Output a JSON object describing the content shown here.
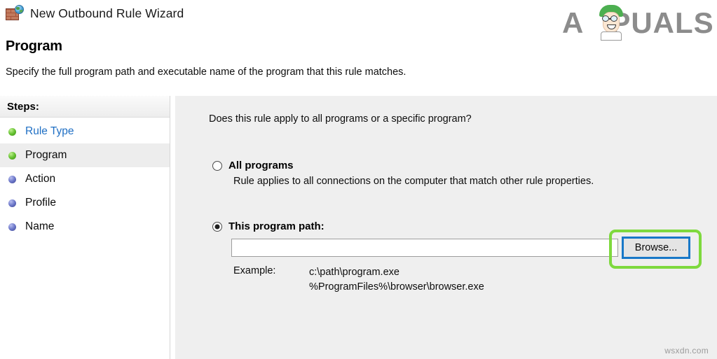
{
  "window": {
    "title": "New Outbound Rule Wizard",
    "icon": "firewall-brick-wall-globe-icon"
  },
  "header": {
    "heading": "Program",
    "subheading": "Specify the full program path and executable name of the program that this rule matches."
  },
  "logo": {
    "text": "A PUALS",
    "prefix": "A",
    "suffix": "PUALS",
    "color": "#8c8c8c",
    "hair_color": "#4caf50"
  },
  "sidebar": {
    "header_label": "Steps:",
    "items": [
      {
        "label": "Rule Type",
        "bullet": "green",
        "state": "completed-link",
        "active": false
      },
      {
        "label": "Program",
        "bullet": "green",
        "state": "current",
        "active": true
      },
      {
        "label": "Action",
        "bullet": "blue",
        "state": "pending",
        "active": false
      },
      {
        "label": "Profile",
        "bullet": "blue",
        "state": "pending",
        "active": false
      },
      {
        "label": "Name",
        "bullet": "blue",
        "state": "pending",
        "active": false
      }
    ]
  },
  "content": {
    "question": "Does this rule apply to all programs or a specific program?",
    "options": [
      {
        "id": "all-programs",
        "label": "All programs",
        "description": "Rule applies to all connections on the computer that match other rule properties.",
        "selected": false
      },
      {
        "id": "this-program-path",
        "label": "This program path:",
        "selected": true
      }
    ],
    "path_input": {
      "value": "",
      "placeholder": ""
    },
    "browse_button": {
      "label": "Browse...",
      "focus_border_color": "#1878c8",
      "highlight_color": "#7ed93e"
    },
    "example": {
      "label": "Example:",
      "paths": [
        "c:\\path\\program.exe",
        "%ProgramFiles%\\browser\\browser.exe"
      ]
    }
  },
  "watermark": "wsxdn.com"
}
